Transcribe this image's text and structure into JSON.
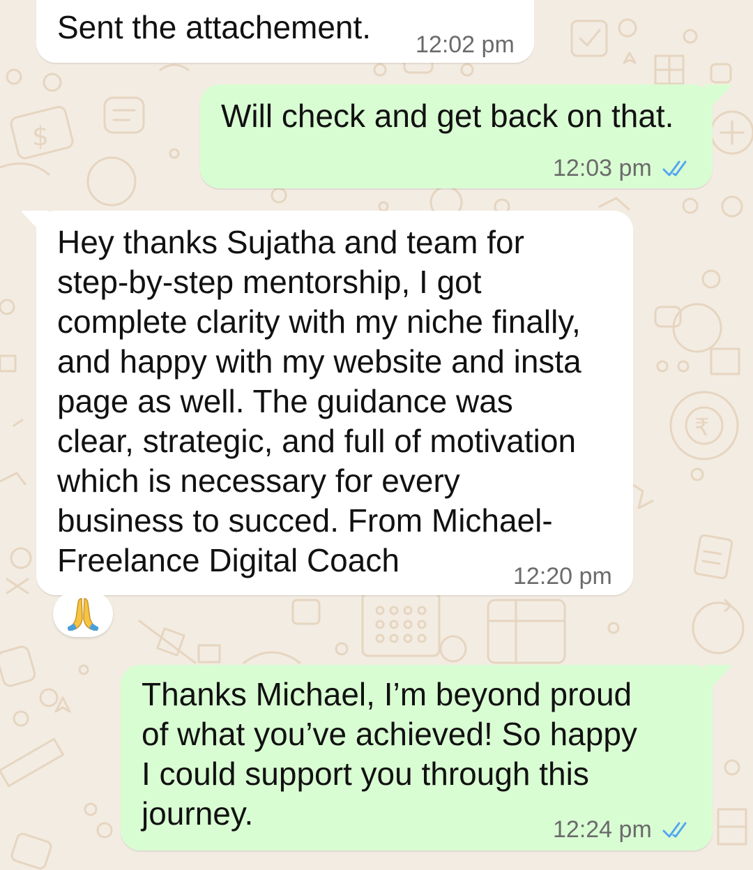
{
  "messages": [
    {
      "id": "m1",
      "direction": "incoming",
      "text": "Sent the attachement.",
      "time": "12:02 pm"
    },
    {
      "id": "m2",
      "direction": "outgoing",
      "text": "Will check and get back on that.",
      "time": "12:03 pm",
      "status_icon": "double-check-read-icon"
    },
    {
      "id": "m3",
      "direction": "incoming",
      "text": "Hey thanks Sujatha and team for\nstep-by-step mentorship, I got\ncomplete clarity with my niche finally,\nand happy with my website and insta\npage as well. The guidance was\nclear, strategic, and full of motivation\nwhich is necessary for every\nbusiness to succed. From Michael-\nFreelance Digital Coach",
      "time": "12:20 pm",
      "reaction_icon": "folded-hands-emoji"
    },
    {
      "id": "m4",
      "direction": "outgoing",
      "text": "Thanks Michael, I’m beyond proud\nof what you’ve achieved! So happy\nI could support you through this\njourney.",
      "time": "12:24 pm",
      "status_icon": "double-check-read-icon"
    }
  ],
  "colors": {
    "wallpaper": "#f3ece2",
    "wallpaper_doodle": "#e7d7c3",
    "incoming_bubble": "#ffffff",
    "outgoing_bubble": "#d9fdd3",
    "text": "#111111",
    "timestamp": "#6b6b6b",
    "read_ticks": "#53a6f0"
  }
}
